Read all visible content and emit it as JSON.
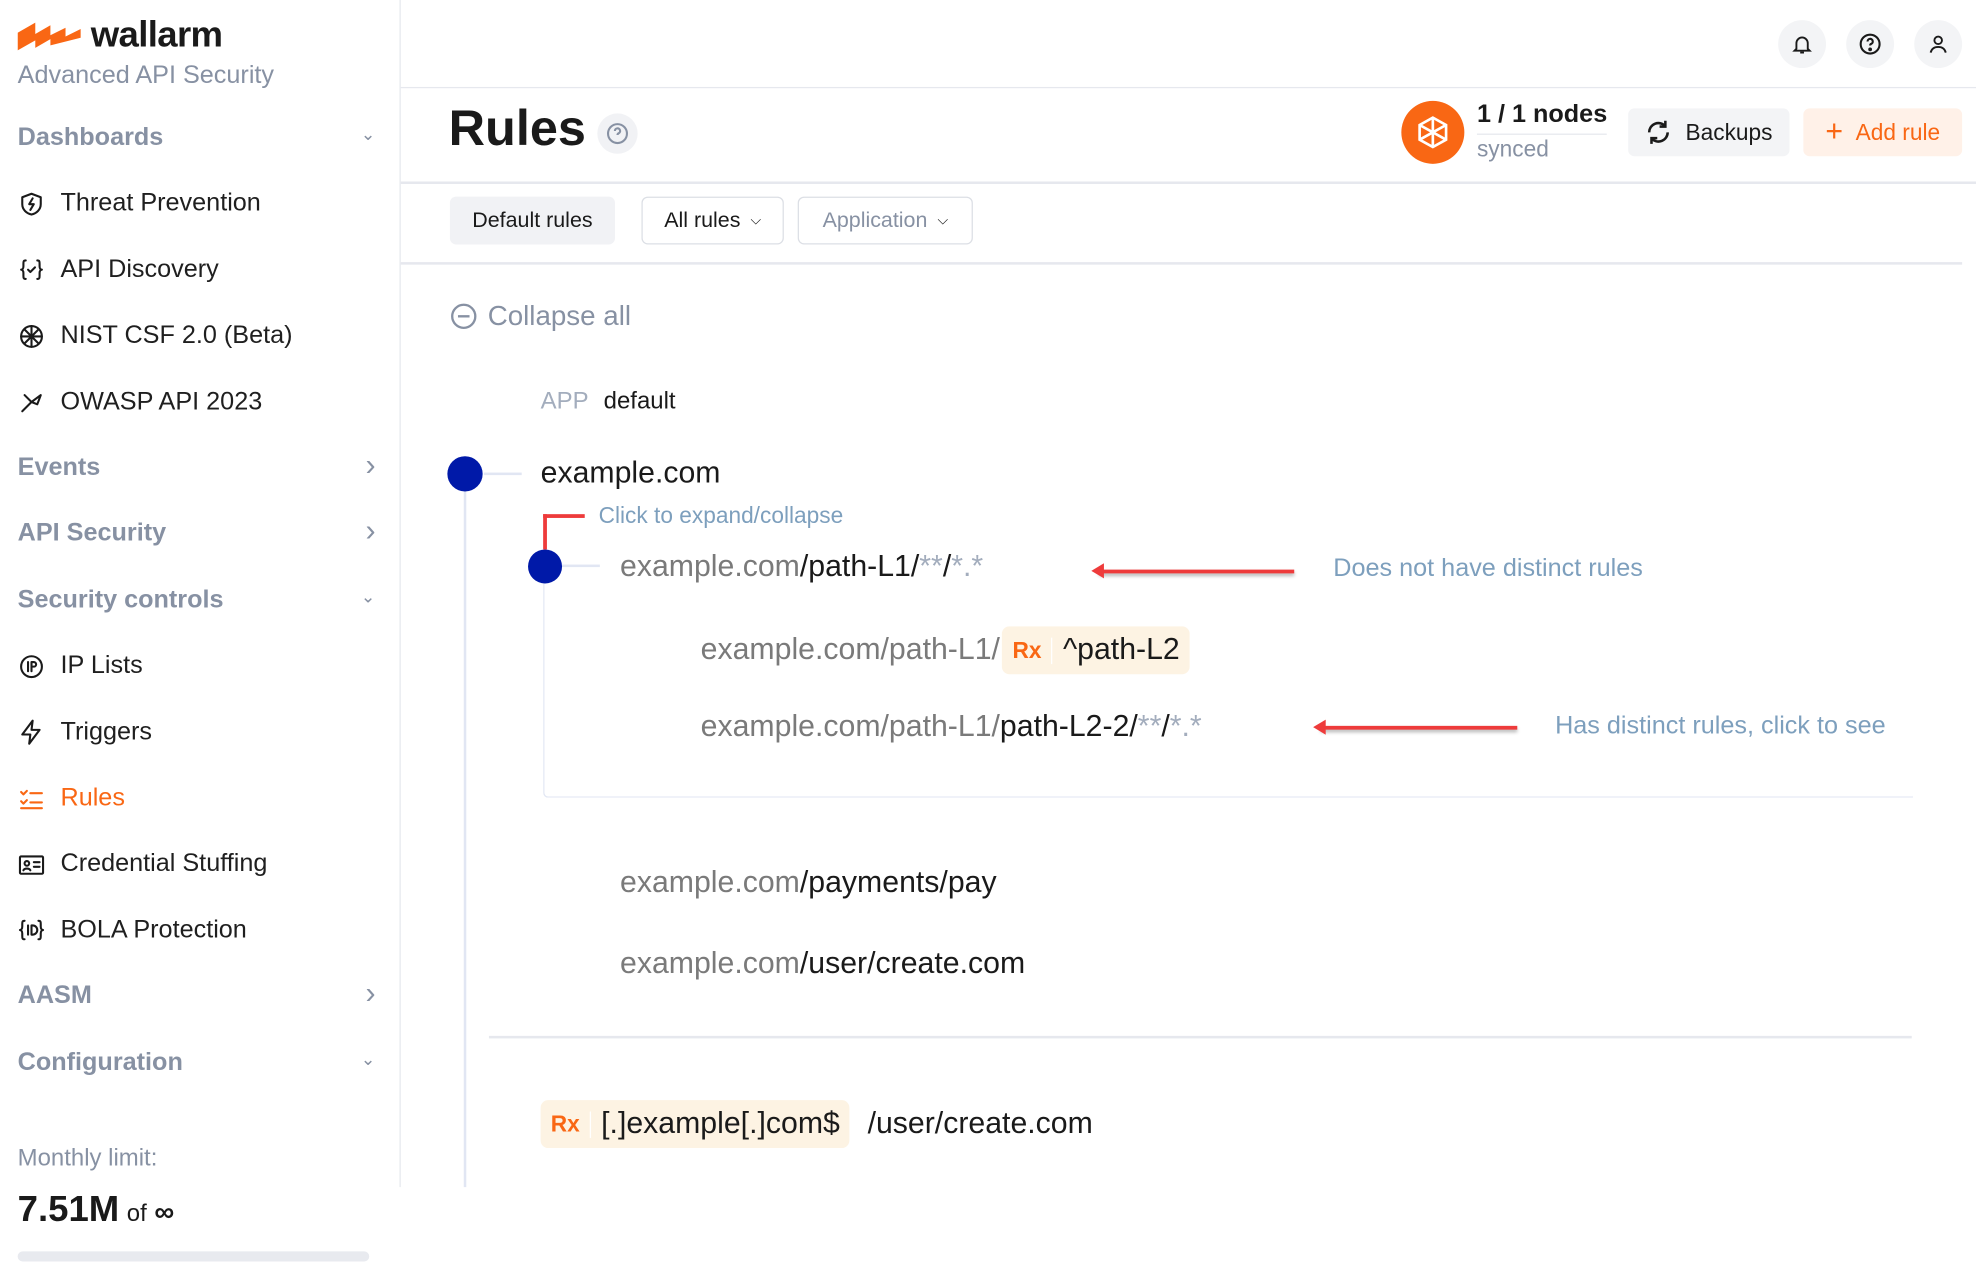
{
  "brand": {
    "name": "wallarm",
    "subtitle": "Advanced API Security",
    "color": "#f96714"
  },
  "sidebar": {
    "items": [
      {
        "label": "Dashboards",
        "type": "group",
        "chevron": "down"
      },
      {
        "label": "Threat Prevention",
        "type": "item",
        "icon": "shield-bolt-icon"
      },
      {
        "label": "API Discovery",
        "type": "item",
        "icon": "braces-check-icon"
      },
      {
        "label": "NIST CSF 2.0 (Beta)",
        "type": "item",
        "icon": "nist-icon"
      },
      {
        "label": "OWASP API 2023",
        "type": "item",
        "icon": "wasp-icon"
      },
      {
        "label": "Events",
        "type": "group",
        "chevron": "right"
      },
      {
        "label": "API Security",
        "type": "group",
        "chevron": "right"
      },
      {
        "label": "Security controls",
        "type": "group",
        "chevron": "down"
      },
      {
        "label": "IP Lists",
        "type": "item",
        "icon": "ip-icon"
      },
      {
        "label": "Triggers",
        "type": "item",
        "icon": "bolt-icon"
      },
      {
        "label": "Rules",
        "type": "item",
        "icon": "rules-list-icon",
        "active": true
      },
      {
        "label": "Credential Stuffing",
        "type": "item",
        "icon": "credential-icon"
      },
      {
        "label": "BOLA Protection",
        "type": "item",
        "icon": "id-braces-icon"
      },
      {
        "label": "AASM",
        "type": "group",
        "chevron": "right"
      },
      {
        "label": "Configuration",
        "type": "group",
        "chevron": "down"
      }
    ],
    "limit": {
      "label": "Monthly limit:",
      "value": "7.51M",
      "of": "of",
      "max": "∞",
      "progress": 0
    }
  },
  "header": {
    "title": "Rules",
    "nodes": "1 / 1 nodes",
    "nodes_status": "synced",
    "backups_label": "Backups",
    "add_rule_label": "Add rule"
  },
  "filters": {
    "default_rules": "Default rules",
    "all_rules": "All rules",
    "application": "Application"
  },
  "tree": {
    "collapse_all": "Collapse all",
    "app_label": "APP",
    "app_value": "default",
    "root": "example.com",
    "rx_badge": "Rx",
    "rows": [
      [
        {
          "t": "example.com",
          "s": "host"
        },
        {
          "t": "/path-L1/",
          "s": "path"
        },
        {
          "t": "**",
          "s": "wild"
        },
        {
          "t": "/",
          "s": "path"
        },
        {
          "t": "*.*",
          "s": "wild"
        }
      ],
      [
        {
          "t": "example.com/path-L1/",
          "s": "host"
        }
      ],
      [
        {
          "t": "example.com/path-L1/",
          "s": "host"
        },
        {
          "t": "path-L2-2/",
          "s": "path"
        },
        {
          "t": "**",
          "s": "wild"
        },
        {
          "t": "/",
          "s": "path"
        },
        {
          "t": "*.*",
          "s": "wild"
        }
      ],
      [
        {
          "t": "example.com",
          "s": "host"
        },
        {
          "t": "/payments/pay",
          "s": "path"
        }
      ],
      [
        {
          "t": "example.com",
          "s": "host"
        },
        {
          "t": "/user/create.com",
          "s": "path"
        }
      ]
    ],
    "row2_regex": "^path-L2",
    "last_regex": "[.]example[.]com$",
    "last_path": "/user/create.com"
  },
  "annotations": {
    "expand": "Click to expand/collapse",
    "no_distinct": "Does not have distinct rules",
    "has_distinct": "Has distinct rules, click to see"
  }
}
